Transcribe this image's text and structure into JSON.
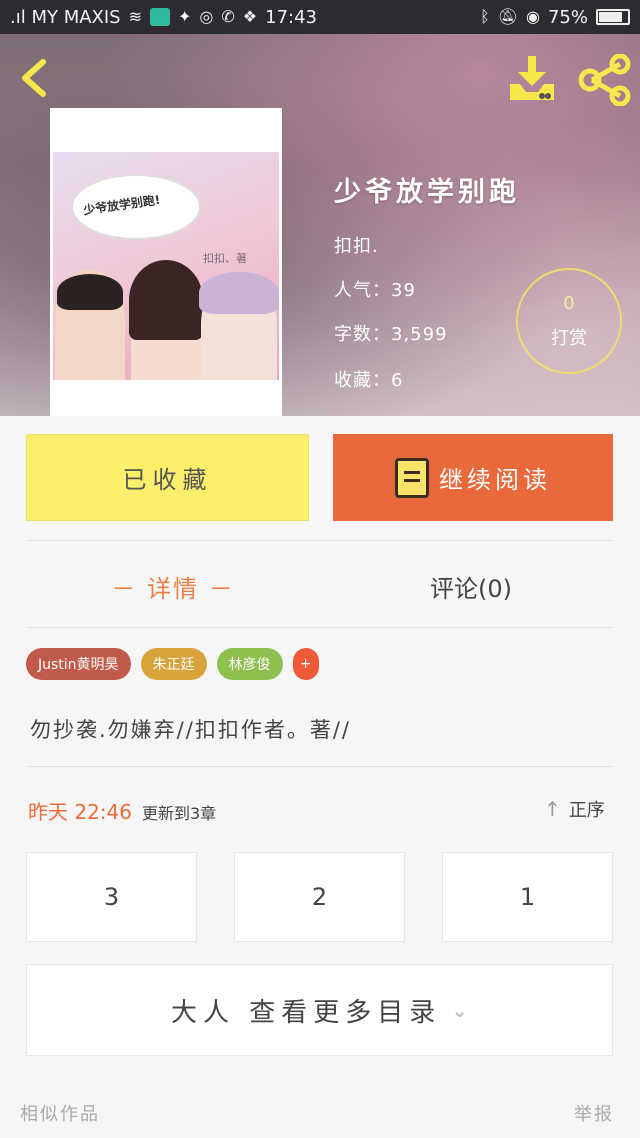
{
  "status_bar": {
    "carrier": ".ıl MY MAXIS",
    "time": "17:43",
    "battery": "75%"
  },
  "book": {
    "title": "少爷放学别跑",
    "author": "扣扣.",
    "popularity": "人气：39",
    "word_count": "字数：3,599",
    "favorites": "收藏：6",
    "cover_text": "少爷放学别跑!",
    "cover_author": "扣扣、著"
  },
  "tip": {
    "count": "0",
    "label": "打赏"
  },
  "actions": {
    "favorited_label": "已收藏",
    "continue_label": "继续阅读"
  },
  "tabs": {
    "details": "－ 详情 －",
    "comments": "评论(0)"
  },
  "tags": [
    {
      "label": "Justin黄明昊",
      "color": "#c05a4a"
    },
    {
      "label": "朱正廷",
      "color": "#d8a33a"
    },
    {
      "label": "林彦俊",
      "color": "#8fbf4e"
    },
    {
      "label": "+",
      "color": "#ef5b37"
    }
  ],
  "intro": "勿抄袭.勿嫌弃//扣扣作者。著//",
  "update": {
    "time": "昨天 22:46",
    "text": "更新到3章",
    "sort_label": "正序"
  },
  "chapters": [
    "3",
    "2",
    "1"
  ],
  "more_toc_label": "大人 查看更多目录",
  "footer": {
    "similar": "相似作品",
    "report": "举报"
  },
  "colors": {
    "accent_orange": "#e9693a",
    "accent_yellow": "#fbef6c",
    "icon_yellow": "#f6e74c"
  }
}
